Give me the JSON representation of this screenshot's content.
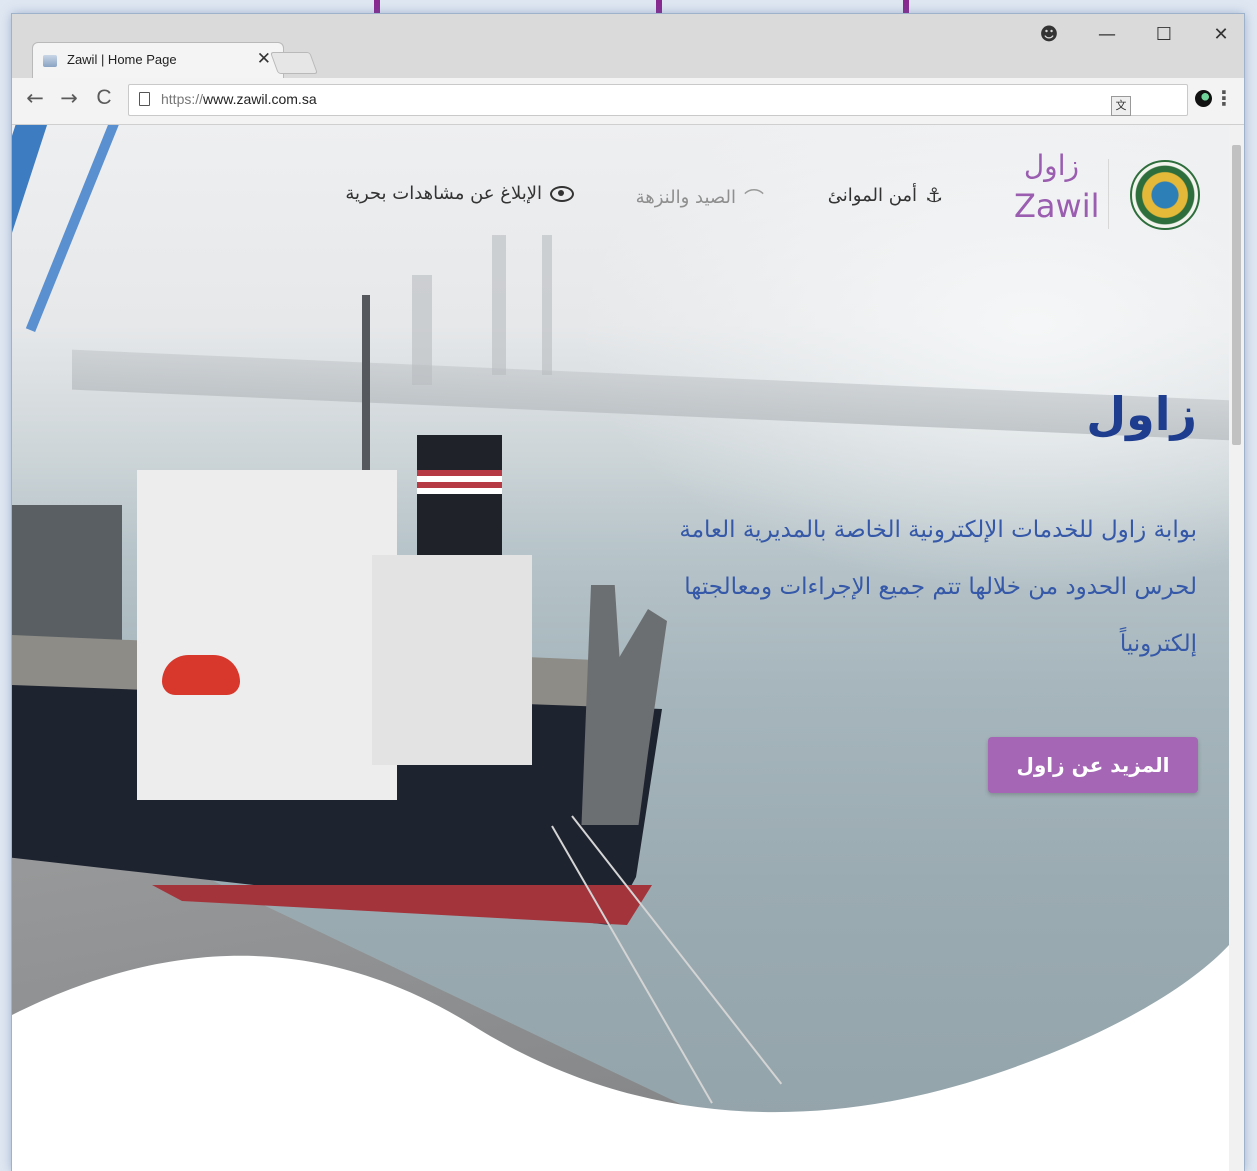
{
  "browser": {
    "tab_title": "Zawil | Home Page",
    "tab_close": "✕",
    "url_scheme": "https://",
    "url_host": "www.zawil.com.sa",
    "window_controls": {
      "account": "☻",
      "minimize": "—",
      "maximize": "☐",
      "close": "✕"
    },
    "nav": {
      "back": "←",
      "forward": "→",
      "reload": "C"
    },
    "menu": "⋮"
  },
  "site": {
    "logo_ar": "زاول",
    "logo_en": "Zawil",
    "nav": [
      {
        "label": "أمن الموانئ",
        "icon": "anchor-icon"
      },
      {
        "label": "الصيد والنزهة",
        "icon": "fishing-rod-icon"
      },
      {
        "label": "الإبلاغ عن مشاهدات بحرية",
        "icon": "eye-icon"
      }
    ],
    "hero": {
      "title": "زاول",
      "text": "بوابة زاول للخدمات الإلكترونية الخاصة بالمديرية العامة لحرس الحدود من خلالها تتم جميع الإجراءات ومعالجتها إلكترونياً",
      "button": "المزيد عن زاول"
    }
  },
  "colors": {
    "accent": "#a566b6",
    "arrow": "#8a2a91",
    "title": "#1f3d8e",
    "text": "#3558a8"
  }
}
